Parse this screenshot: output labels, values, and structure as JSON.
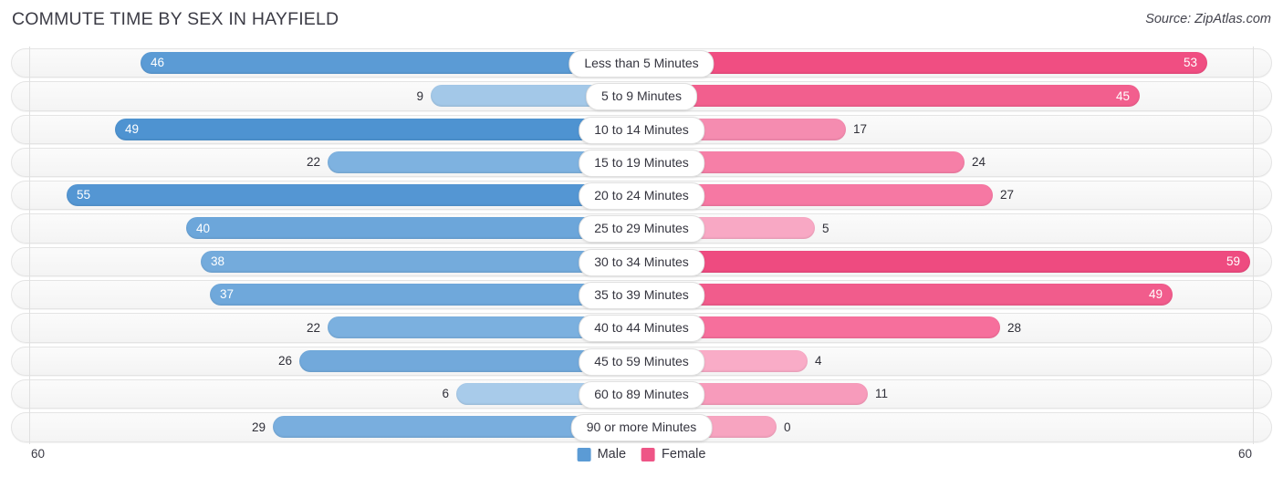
{
  "header": {
    "title": "COMMUTE TIME BY SEX IN HAYFIELD",
    "source": "Source: ZipAtlas.com"
  },
  "legend": {
    "male_label": "Male",
    "female_label": "Female",
    "male_color": "#5B9BD5",
    "female_color": "#EE5586"
  },
  "axis": {
    "left_end": "60",
    "right_end": "60"
  },
  "chart_data": {
    "type": "bar",
    "title": "COMMUTE TIME BY SEX IN HAYFIELD",
    "subtitle": "Source: ZipAtlas.com",
    "orientation": "horizontal-diverging",
    "xlabel": "",
    "ylabel": "",
    "xlim": [
      60,
      60
    ],
    "axis_max_per_side": 60,
    "grid": false,
    "legend_position": "bottom-center",
    "categories": [
      "Less than 5 Minutes",
      "5 to 9 Minutes",
      "10 to 14 Minutes",
      "15 to 19 Minutes",
      "20 to 24 Minutes",
      "25 to 29 Minutes",
      "30 to 34 Minutes",
      "35 to 39 Minutes",
      "40 to 44 Minutes",
      "45 to 59 Minutes",
      "60 to 89 Minutes",
      "90 or more Minutes"
    ],
    "series": [
      {
        "name": "Male",
        "color": "#5B9BD5",
        "direction": "left",
        "values": [
          46,
          9,
          49,
          22,
          55,
          40,
          38,
          37,
          22,
          26,
          6,
          29
        ]
      },
      {
        "name": "Female",
        "color": "#EE5586",
        "direction": "right",
        "values": [
          53,
          45,
          17,
          24,
          27,
          5,
          59,
          49,
          28,
          4,
          11,
          0
        ]
      }
    ]
  },
  "rows": [
    {
      "label": "Less than 5 Minutes",
      "male": "46",
      "female": "53",
      "male_w": 549,
      "female_w": 620,
      "male_inside": true,
      "female_inside": true,
      "male_color": "#5B9BD5",
      "female_color": "#F04E82"
    },
    {
      "label": "5 to 9 Minutes",
      "male": "9",
      "female": "45",
      "male_w": 231,
      "female_w": 546,
      "male_inside": false,
      "female_inside": true,
      "male_color": "#A3C8E8",
      "female_color": "#F25F8E"
    },
    {
      "label": "10 to 14 Minutes",
      "male": "49",
      "female": "17",
      "male_w": 577,
      "female_w": 224,
      "male_inside": true,
      "female_inside": false,
      "male_color": "#4E93D1",
      "female_color": "#F58CB0"
    },
    {
      "label": "15 to 19 Minutes",
      "male": "22",
      "female": "24",
      "male_w": 344,
      "female_w": 354,
      "male_inside": false,
      "female_inside": false,
      "male_color": "#7EB2E0",
      "female_color": "#F67FA7"
    },
    {
      "label": "20 to 24 Minutes",
      "male": "55",
      "female": "27",
      "male_w": 630,
      "female_w": 385,
      "male_inside": true,
      "female_inside": false,
      "male_color": "#5496D3",
      "female_color": "#F678A3"
    },
    {
      "label": "25 to 29 Minutes",
      "male": "40",
      "female": "5",
      "male_w": 499,
      "female_w": 190,
      "male_inside": true,
      "female_inside": false,
      "male_color": "#6CA6DA",
      "female_color": "#F8A8C4"
    },
    {
      "label": "30 to 34 Minutes",
      "male": "38",
      "female": "59",
      "male_w": 483,
      "female_w": 667,
      "male_inside": true,
      "female_inside": true,
      "male_color": "#74ABDC",
      "female_color": "#EE4B80"
    },
    {
      "label": "35 to 39 Minutes",
      "male": "37",
      "female": "49",
      "male_w": 473,
      "female_w": 582,
      "male_inside": true,
      "female_inside": true,
      "male_color": "#6FA8DB",
      "female_color": "#F15C8C"
    },
    {
      "label": "40 to 44 Minutes",
      "male": "22",
      "female": "28",
      "male_w": 344,
      "female_w": 393,
      "male_inside": false,
      "female_inside": false,
      "male_color": "#7BB0DF",
      "female_color": "#F66F9C"
    },
    {
      "label": "45 to 59 Minutes",
      "male": "26",
      "female": "4",
      "male_w": 375,
      "female_w": 182,
      "male_inside": false,
      "female_inside": false,
      "male_color": "#72A9DB",
      "female_color": "#F9ACC7"
    },
    {
      "label": "60 to 89 Minutes",
      "male": "6",
      "female": "11",
      "male_w": 203,
      "female_w": 248,
      "male_inside": false,
      "female_inside": false,
      "male_color": "#A8CBEA",
      "female_color": "#F79BBB"
    },
    {
      "label": "90 or more Minutes",
      "male": "29",
      "female": "0",
      "male_w": 404,
      "female_w": 148,
      "male_inside": false,
      "female_inside": false,
      "male_color": "#79AEDE",
      "female_color": "#F7A4C0"
    }
  ]
}
